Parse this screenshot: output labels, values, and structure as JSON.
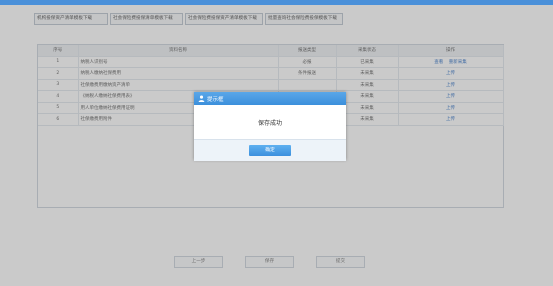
{
  "top_links": [
    "机构投保资产清单模板下载",
    "社会保险费投保清单模板下载",
    "社会保险费投保资产清单模板下载",
    "批量查询社会保险费投保模板下载"
  ],
  "table": {
    "headers": [
      "序号",
      "资料名称",
      "报送类型",
      "采集状态",
      "操作"
    ],
    "rows": [
      {
        "no": "1",
        "name": "纳税人识别号",
        "type": "必报",
        "status": "已采集",
        "ops": [
          "查看",
          "重新采集"
        ]
      },
      {
        "no": "2",
        "name": "纳税人缴纳社保费用",
        "type": "条件报送",
        "status": "未采集",
        "ops": [
          "上传"
        ]
      },
      {
        "no": "3",
        "name": "社保缴费用缴纳资产清单",
        "type": "",
        "status": "未采集",
        "ops": [
          "上传"
        ]
      },
      {
        "no": "4",
        "name": "《纳税人缴纳社保费用表》",
        "type": "",
        "status": "未采集",
        "ops": [
          "上传"
        ]
      },
      {
        "no": "5",
        "name": "用人单位缴纳社保费用证明",
        "type": "",
        "status": "未采集",
        "ops": [
          "上传"
        ]
      },
      {
        "no": "6",
        "name": "社保缴费用附件",
        "type": "",
        "status": "未采集",
        "ops": [
          "上传"
        ]
      }
    ]
  },
  "bottom_buttons": [
    "上一步",
    "保存",
    "提交"
  ],
  "dialog": {
    "title": "提示框",
    "message": "保存成功",
    "confirm_label": "确定"
  },
  "colors": {
    "header_blue": "#3b8fdc",
    "link_blue": "#3b78c8",
    "overlay": "rgba(80,80,80,0.30)"
  }
}
